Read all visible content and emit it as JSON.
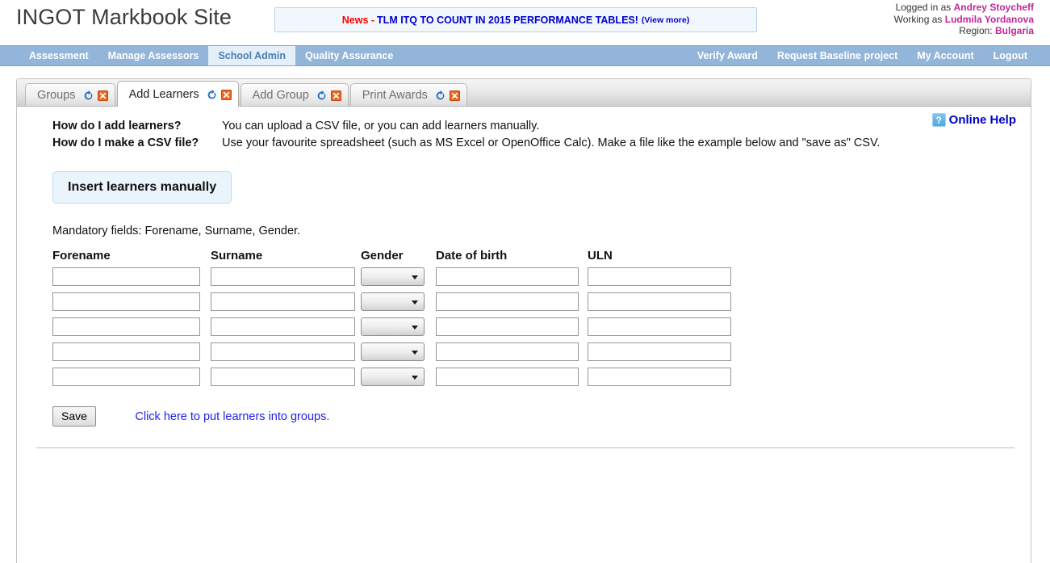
{
  "header": {
    "site_title": "INGOT Markbook Site",
    "news": {
      "label": "News -",
      "text": "TLM ITQ TO COUNT IN 2015 PERFORMANCE TABLES!",
      "view_more": "(View more)"
    },
    "user": {
      "logged_in_prefix": "Logged in as",
      "logged_in_name": "Andrey Stoycheff",
      "working_as_prefix": "Working as",
      "working_as_name": "Ludmila Yordanova",
      "region_prefix": "Region:",
      "region_name": "Bulgaria"
    }
  },
  "nav": {
    "left": [
      {
        "label": "Assessment",
        "active": false
      },
      {
        "label": "Manage Assessors",
        "active": false
      },
      {
        "label": "School Admin",
        "active": true
      },
      {
        "label": "Quality Assurance",
        "active": false
      }
    ],
    "right": [
      {
        "label": "Verify Award"
      },
      {
        "label": "Request Baseline project"
      },
      {
        "label": "My Account"
      },
      {
        "label": "Logout"
      }
    ]
  },
  "tabs": [
    {
      "label": "Groups",
      "active": false,
      "refresh_icon": "refresh-icon",
      "close_icon": "close-icon"
    },
    {
      "label": "Add Learners",
      "active": true,
      "refresh_icon": "refresh-icon",
      "close_icon": "close-icon"
    },
    {
      "label": "Add Group",
      "active": false,
      "refresh_icon": "refresh-icon",
      "close_icon": "close-icon"
    },
    {
      "label": "Print Awards",
      "active": false,
      "refresh_icon": "refresh-icon",
      "close_icon": "close-icon"
    }
  ],
  "faq": [
    {
      "question": "How do I add learners?",
      "answer": "You can upload a CSV file, or you can add learners manually."
    },
    {
      "question": "How do I make a CSV file?",
      "answer": "Use your favourite spreadsheet (such as MS Excel or OpenOffice Calc). Make a file like the example below and \"save as\" CSV."
    }
  ],
  "online_help": {
    "icon": "question-mark-icon",
    "icon_glyph": "?",
    "label": "Online Help"
  },
  "main": {
    "insert_button": "Insert learners manually",
    "mandatory_note": "Mandatory fields: Forename, Surname, Gender.",
    "save_button": "Save",
    "groups_link": "Click here to put learners into groups."
  },
  "table": {
    "headers": [
      "Forename",
      "Surname",
      "Gender",
      "Date of birth",
      "ULN"
    ],
    "rows": [
      {
        "forename": "",
        "surname": "",
        "gender": "",
        "dob": "",
        "uln": ""
      },
      {
        "forename": "",
        "surname": "",
        "gender": "",
        "dob": "",
        "uln": ""
      },
      {
        "forename": "",
        "surname": "",
        "gender": "",
        "dob": "",
        "uln": ""
      },
      {
        "forename": "",
        "surname": "",
        "gender": "",
        "dob": "",
        "uln": ""
      },
      {
        "forename": "",
        "surname": "",
        "gender": "",
        "dob": "",
        "uln": ""
      }
    ]
  },
  "colors": {
    "nav_bar": "#93b5d9",
    "nav_active_bg": "#e4effa",
    "nav_active_text": "#4a7fb5",
    "news_red": "#ff0000",
    "news_blue": "#0000cc",
    "user_accent": "#c0279b",
    "link_blue": "#2020ee",
    "insert_btn_bg": "#eaf4fb",
    "help_icon_blue": "#4fa8e0"
  }
}
